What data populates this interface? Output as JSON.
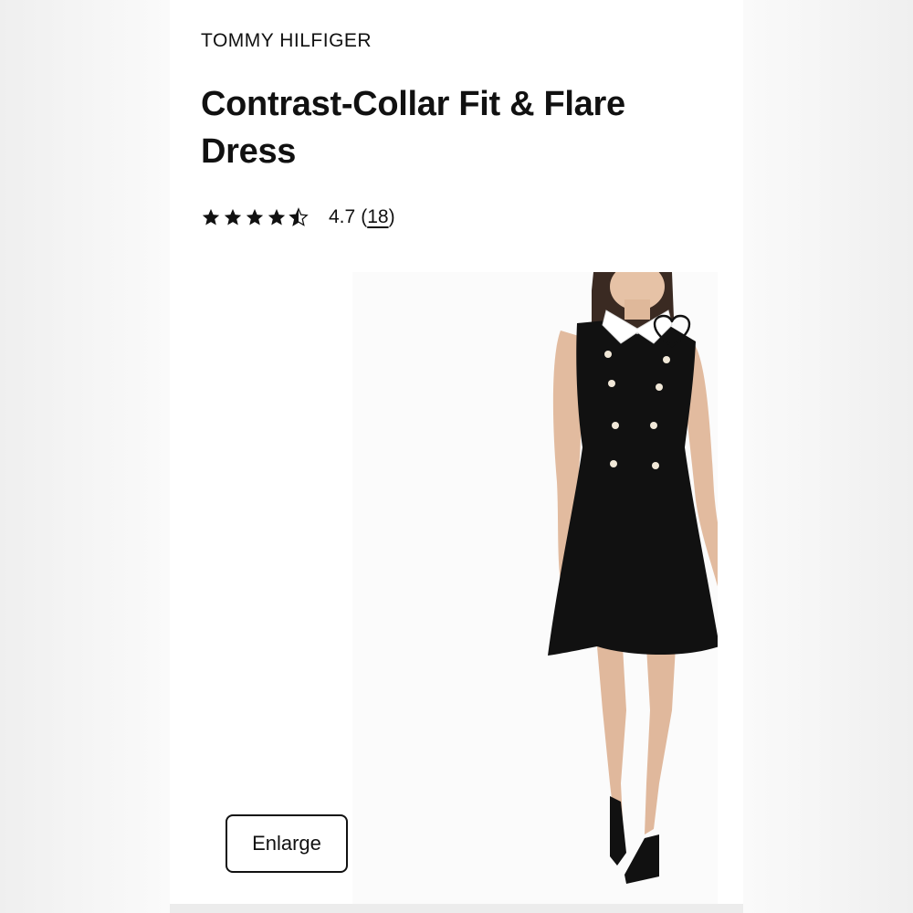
{
  "product": {
    "brand": "TOMMY HILFIGER",
    "title_line1": "Contrast-Collar Fit & Flare",
    "title_line2": "Dress",
    "rating": {
      "stars": 4.7,
      "value": "4.7",
      "count_open": "(",
      "count": "18",
      "count_close": ")"
    }
  },
  "image": {
    "description": "model-wearing-black-sleeveless-dress-with-white-collar",
    "dress_color": "#111111",
    "collar_color": "#ffffff"
  },
  "actions": {
    "enlarge_label": "Enlarge",
    "wishlist_icon": "heart-outline-icon"
  }
}
